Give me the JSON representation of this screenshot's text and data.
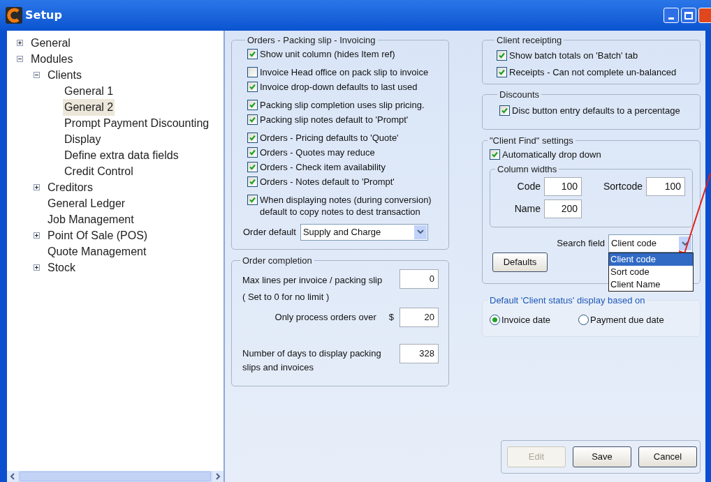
{
  "window": {
    "title": "Setup"
  },
  "tree": [
    {
      "label": "General",
      "kind": "folder",
      "expanded": false,
      "selected": false
    },
    {
      "label": "Modules",
      "kind": "folder",
      "expanded": true,
      "selected": false,
      "children": [
        {
          "label": "Clients",
          "kind": "folder",
          "expanded": true,
          "selected": false,
          "children": [
            {
              "label": "General 1",
              "kind": "leaf",
              "selected": false
            },
            {
              "label": "General 2",
              "kind": "leaf",
              "selected": true
            },
            {
              "label": "Prompt Payment Discounting",
              "kind": "leaf",
              "selected": false
            },
            {
              "label": "Display",
              "kind": "leaf",
              "selected": false
            },
            {
              "label": "Define extra data fields",
              "kind": "leaf",
              "selected": false
            },
            {
              "label": "Credit Control",
              "kind": "leaf",
              "selected": false
            }
          ]
        },
        {
          "label": "Creditors",
          "kind": "folder",
          "expanded": false,
          "selected": false
        },
        {
          "label": "General Ledger",
          "kind": "leaf",
          "selected": false
        },
        {
          "label": "Job Management",
          "kind": "leaf",
          "selected": false
        },
        {
          "label": "Point Of Sale (POS)",
          "kind": "folder",
          "expanded": false,
          "selected": false
        },
        {
          "label": "Quote Management",
          "kind": "leaf",
          "selected": false
        },
        {
          "label": "Stock",
          "kind": "folder",
          "expanded": false,
          "selected": false
        }
      ]
    }
  ],
  "orders_group": {
    "title": "Orders - Packing slip - Invoicing",
    "option_groups": [
      [
        {
          "label": "Show unit column (hides Item ref)",
          "checked": true
        }
      ],
      [
        {
          "label": "Invoice Head office on pack slip to invoice",
          "checked": false
        },
        {
          "label": "Invoice drop-down defaults to last used",
          "checked": true
        }
      ],
      [
        {
          "label": "Packing slip completion uses slip pricing.",
          "checked": true
        },
        {
          "label": "Packing slip notes default to 'Prompt'",
          "checked": true
        }
      ],
      [
        {
          "label": "Orders - Pricing defaults to 'Quote'",
          "checked": true
        },
        {
          "label": "Orders - Quotes may reduce",
          "checked": true
        },
        {
          "label": "Orders - Check item availability",
          "checked": true
        },
        {
          "label": "Orders - Notes default to 'Prompt'",
          "checked": true
        }
      ],
      [
        {
          "label": "When displaying notes (during conversion) default to copy notes to dest transaction",
          "checked": true
        }
      ]
    ],
    "order_default": {
      "label": "Order default",
      "value": "Supply and Charge"
    }
  },
  "order_completion": {
    "title": "Order completion",
    "max_lines": {
      "label": "Max lines per invoice / packing slip",
      "note": "( Set to 0 for no limit )",
      "value": "0"
    },
    "min_order": {
      "label": "Only process orders over",
      "prefix": "$",
      "value": "20"
    },
    "days": {
      "label": "Number of days to display packing slips and invoices",
      "value": "328"
    }
  },
  "client_receipting": {
    "title": "Client receipting",
    "options": [
      {
        "label": "Show batch totals on 'Batch' tab",
        "checked": true
      },
      {
        "label": "Receipts - Can not complete un-balanced",
        "checked": true
      }
    ]
  },
  "discounts": {
    "title": "Discounts",
    "options": [
      {
        "label": "Disc button entry defaults to a percentage",
        "checked": true
      }
    ]
  },
  "client_find": {
    "title": "\"Client Find\" settings",
    "option": {
      "label": "Automatically drop down",
      "checked": true
    },
    "column_widths": {
      "title": "Column widths",
      "fields": [
        {
          "label": "Code",
          "value": "100"
        },
        {
          "label": "Sortcode",
          "value": "100"
        },
        {
          "label": "Name",
          "value": "200"
        }
      ]
    },
    "search_field": {
      "label": "Search field",
      "value": "Client code",
      "options": [
        {
          "label": "Client code",
          "selected": true
        },
        {
          "label": "Sort code",
          "selected": false
        },
        {
          "label": "Client Name",
          "selected": false
        }
      ]
    },
    "defaults_button": "Defaults"
  },
  "client_status": {
    "title": "Default 'Client status' display based on",
    "options": [
      {
        "label": "Invoice date",
        "selected": true
      },
      {
        "label": "Payment due date",
        "selected": false
      }
    ]
  },
  "buttons": [
    {
      "label": "Edit",
      "disabled": true
    },
    {
      "label": "Save",
      "disabled": false
    },
    {
      "label": "Cancel",
      "disabled": false
    }
  ]
}
